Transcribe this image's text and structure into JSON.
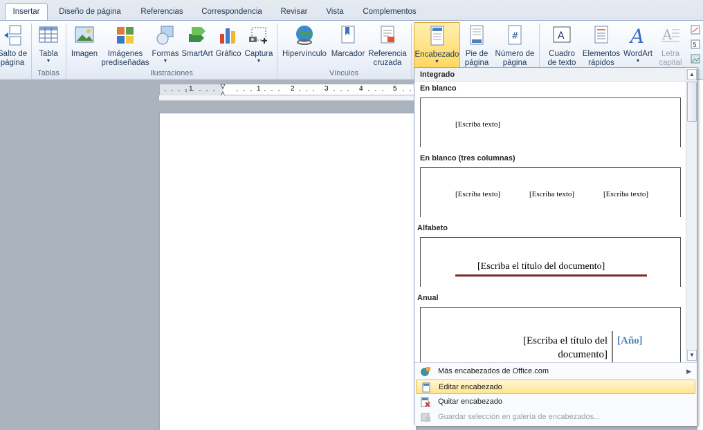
{
  "tabs": [
    "Insertar",
    "Diseño de página",
    "Referencias",
    "Correspondencia",
    "Revisar",
    "Vista",
    "Complementos"
  ],
  "ribbon": {
    "buttons": {
      "salto": "Salto de\npágina",
      "tabla": "Tabla",
      "imagen": "Imagen",
      "imagenes": "Imágenes\nprediseñadas",
      "formas": "Formas",
      "smartart": "SmartArt",
      "grafico": "Gráfico",
      "captura": "Captura",
      "hipervinculo": "Hipervínculo",
      "marcador": "Marcador",
      "referencia": "Referencia\ncruzada",
      "encabezado": "Encabezado",
      "pie": "Pie de\npágina",
      "numero": "Número de\npágina",
      "cuadro": "Cuadro\nde texto",
      "elementos": "Elementos\nrápidos",
      "wordart": "WordArt",
      "letra": "Letra\ncapital"
    },
    "groups": {
      "tablas": "Tablas",
      "ilustraciones": "Ilustraciones",
      "vinculos": "Vínculos"
    }
  },
  "ruler": {
    "marks": [
      "1",
      "1",
      "2",
      "3",
      "4",
      "5"
    ]
  },
  "gallery": {
    "integrado": "Integrado",
    "sections": [
      {
        "title": "En blanco",
        "placeholders": [
          "[Escriba texto]"
        ]
      },
      {
        "title": "En blanco (tres columnas)",
        "placeholders": [
          "[Escriba texto]",
          "[Escriba texto]",
          "[Escriba texto]"
        ]
      },
      {
        "title": "Alfabeto",
        "placeholders": [
          "[Escriba el título del documento]"
        ]
      },
      {
        "title": "Anual",
        "placeholders": [
          "[Escriba el título del documento]",
          "[Año]"
        ]
      }
    ]
  },
  "menu": {
    "mas": "Más encabezados de Office.com",
    "editar": "Editar encabezado",
    "quitar": "Quitar encabezado",
    "guardar": "Guardar selección en galería de encabezados..."
  },
  "colors": {
    "accent": "#4f81bd",
    "highlight": "#ffd85c",
    "alfabetoRule": "#7b2a2a"
  }
}
